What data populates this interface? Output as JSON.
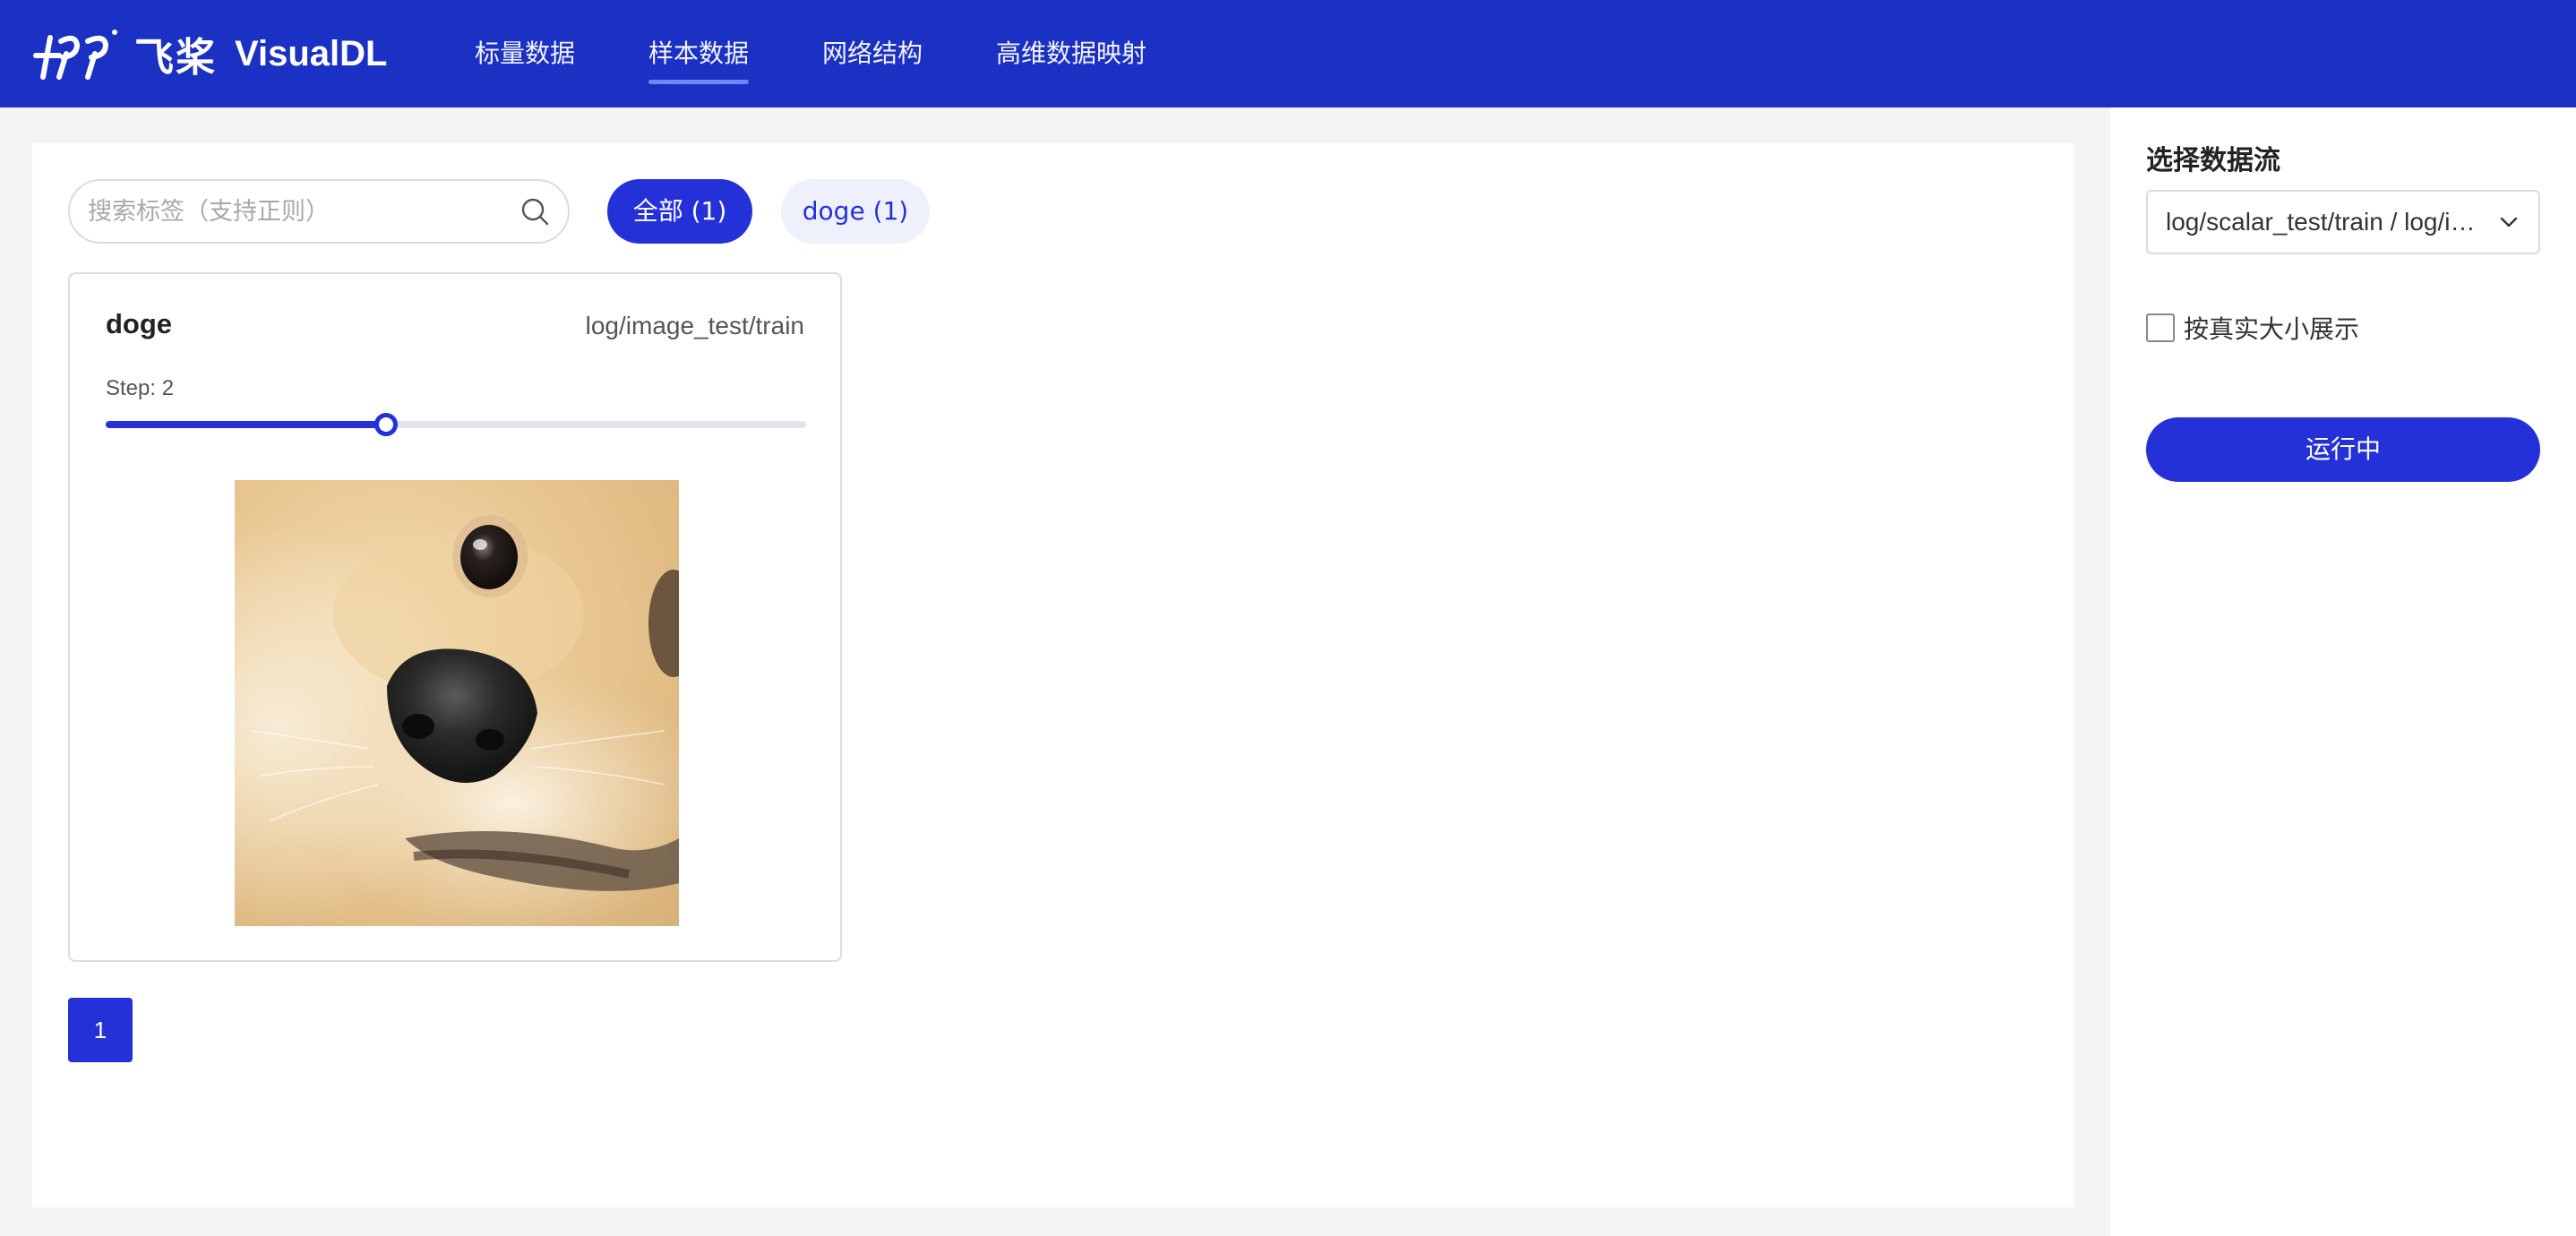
{
  "header": {
    "logo_cn": "飞桨",
    "logo_en": "VisualDL",
    "nav": [
      {
        "label": "标量数据",
        "active": false
      },
      {
        "label": "样本数据",
        "active": true
      },
      {
        "label": "网络结构",
        "active": false
      },
      {
        "label": "高维数据映射",
        "active": false
      }
    ]
  },
  "main": {
    "search": {
      "placeholder": "搜索标签（支持正则）",
      "value": ""
    },
    "tags": [
      {
        "label": "全部 (1)",
        "selected": true
      },
      {
        "label": "doge (1)",
        "selected": false
      }
    ],
    "card": {
      "title": "doge",
      "run": "log/image_test/train",
      "step_label": "Step: 2",
      "slider_fraction": 0.4
    },
    "pagination": {
      "current": "1"
    }
  },
  "side": {
    "title": "选择数据流",
    "select_value": "log/scalar_test/train / log/image_test/train",
    "checkbox_label": "按真实大小展示",
    "checkbox_checked": false,
    "run_button": "运行中"
  },
  "colors": {
    "header_bg": "#1b31c3",
    "accent": "#2431d9",
    "tag_bg": "#eef1fb"
  }
}
